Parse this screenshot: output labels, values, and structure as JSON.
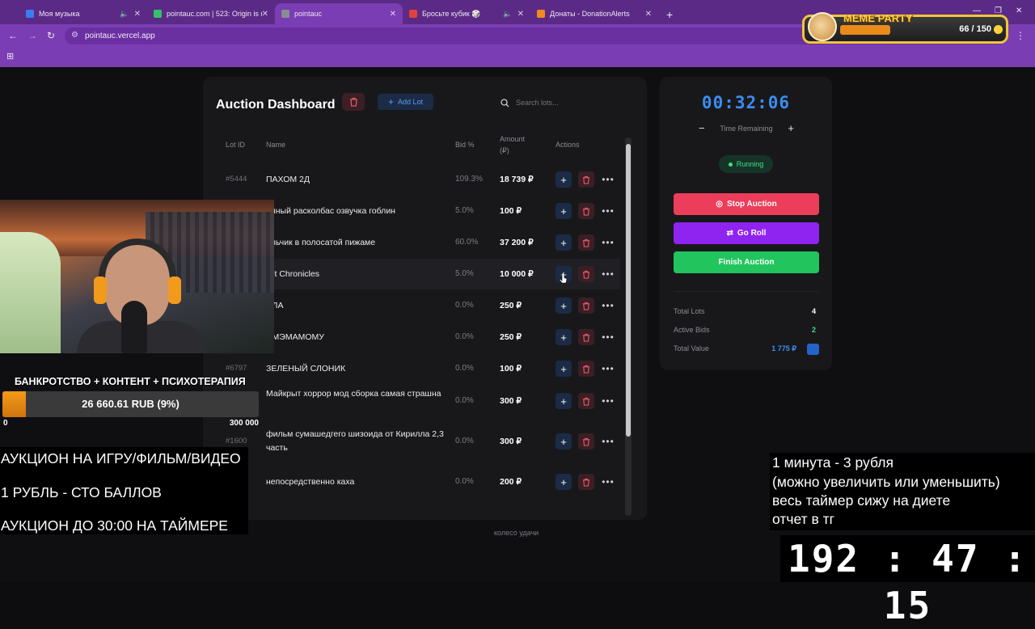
{
  "browser": {
    "tabs": [
      {
        "title": "Моя музыка",
        "fav": "#3b7cf0",
        "muted": true,
        "active": false
      },
      {
        "title": "pointauc.com | 523: Origin is u",
        "fav": "#34c26a",
        "muted": false,
        "active": false
      },
      {
        "title": "pointauc",
        "fav": "#8b8b93",
        "muted": false,
        "active": true
      },
      {
        "title": "Бросьте кубик 🎲",
        "fav": "#e0413c",
        "muted": true,
        "active": false
      },
      {
        "title": "Донаты - DonationAlerts",
        "fav": "#f28a1c",
        "muted": false,
        "active": false
      }
    ],
    "new_tab": "+",
    "url": "pointauc.vercel.app"
  },
  "meme_party": {
    "title": "MEME PARTY",
    "count": "66 / 150"
  },
  "dashboard": {
    "title": "Auction Dashboard",
    "add_lot": "Add Lot",
    "search_placeholder": "Search lots...",
    "columns": {
      "id": "Lot ID",
      "name": "Name",
      "bid": "Bid %",
      "amount": "Amount",
      "amount_unit": "(₽)",
      "actions": "Actions"
    },
    "lots": [
      {
        "id": "#5444",
        "name": "ПАХОМ 2Д",
        "bid": "109.3%",
        "amount": "18 739 ₽"
      },
      {
        "id": "",
        "name": "олный расколбас озвучка гоблин",
        "bid": "5.0%",
        "amount": "100 ₽"
      },
      {
        "id": "",
        "name": "альчик в полосатой пижаме",
        "bid": "60.0%",
        "amount": "37 200 ₽"
      },
      {
        "id": "",
        "name": "ilet Chronicles",
        "bid": "5.0%",
        "amount": "10 000 ₽"
      },
      {
        "id": "",
        "name": "ИЛА",
        "bid": "0.0%",
        "amount": "250 ₽"
      },
      {
        "id": "",
        "name": "ИМЭМАМОМУ",
        "bid": "0.0%",
        "amount": "250 ₽"
      },
      {
        "id": "#6797",
        "name": "ЗЕЛЕНЫЙ СЛОНИК",
        "bid": "0.0%",
        "amount": "100 ₽"
      },
      {
        "id": "",
        "name": "Майкрыт хоррор мод сборка самая страшна",
        "bid": "0.0%",
        "amount": "300 ₽"
      },
      {
        "id": "#1600",
        "name": "фильм сумашедгего шизоида от Кирилла 2,3 часть",
        "bid": "0.0%",
        "amount": "300 ₽"
      },
      {
        "id": "",
        "name": "непосредственно каха",
        "bid": "0.0%",
        "amount": "200 ₽"
      }
    ],
    "footer": "колесо удачи"
  },
  "timer_panel": {
    "time": "00:32:06",
    "time_label": "Time Remaining",
    "status": "Running",
    "stop": "Stop Auction",
    "roll": "Go Roll",
    "finish": "Finish Auction",
    "stats": [
      {
        "label": "Total Lots",
        "value": "4",
        "color": "#ffffff"
      },
      {
        "label": "Active Bids",
        "value": "2",
        "color": "#3fe08a"
      },
      {
        "label": "Total Value",
        "value": "1 775 ₽",
        "color": "#3b8df0"
      }
    ]
  },
  "stream": {
    "goal_title": "БАНКРОТСТВО + КОНТЕНТ + ПСИХОТЕРАПИЯ",
    "goal_value": "26 660.61 RUB (9%)",
    "goal_fraction": 0.09,
    "goal_min": "0",
    "goal_max": "300 000",
    "rules": [
      "АУКЦИОН НА ИГРУ/ФИЛЬМ/ВИДЕО",
      "1 РУБЛЬ - СТО БАЛЛОВ",
      "АУКЦИОН ДО 30:00 НА ТАЙМЕРЕ"
    ],
    "info": [
      "1 минута - 3 рубля",
      "(можно увеличить или уменьшить)",
      "весь таймер сижу на диете",
      "отчет в тг"
    ],
    "big_timer": "192 : 47 : 15"
  }
}
